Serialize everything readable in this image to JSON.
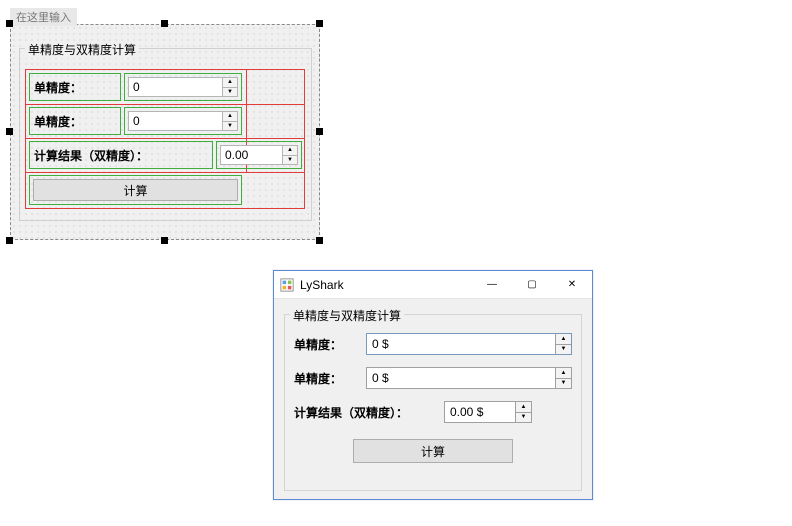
{
  "designer": {
    "placeholder_tab": "在这里输入",
    "group_title": "单精度与双精度计算",
    "rows": {
      "r1_label": "单精度：",
      "r1_value": "0",
      "r2_label": "单精度：",
      "r2_value": "0",
      "r3_label": "计算结果（双精度）：",
      "r3_value": "0.00"
    },
    "button_label": "计算"
  },
  "runtime": {
    "window_title": "LyShark",
    "group_title": "单精度与双精度计算",
    "rows": {
      "r1_label": "单精度：",
      "r1_value": "0 $",
      "r2_label": "单精度：",
      "r2_value": "0 $",
      "r3_label": "计算结果（双精度）：",
      "r3_value": "0.00 $"
    },
    "button_label": "计算"
  },
  "icons": {
    "up": "▲",
    "down": "▼",
    "min": "—",
    "max": "▢",
    "close": "✕"
  }
}
